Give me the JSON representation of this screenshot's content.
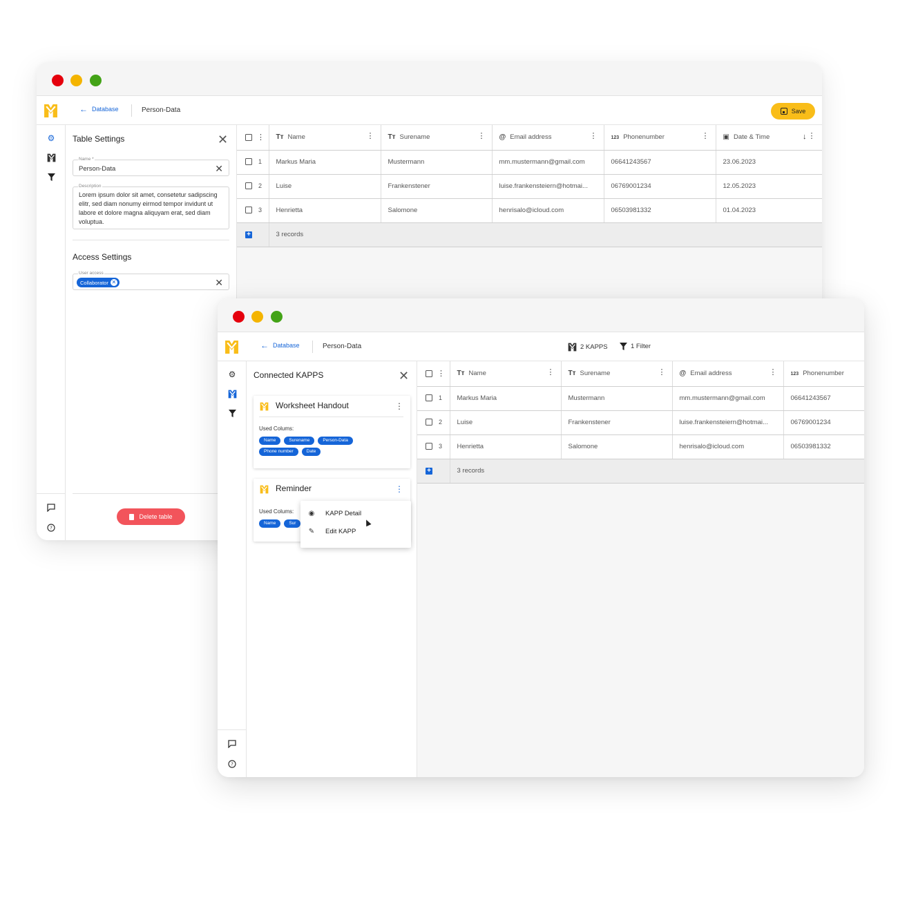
{
  "brand": {
    "accent": "#f9bd19",
    "link": "#1565d8",
    "danger": "#f2545b"
  },
  "back_window": {
    "breadcrumb": {
      "back_label": "Database",
      "current": "Person-Data"
    },
    "save_label": "Save",
    "panel": {
      "title": "Table Settings",
      "name_label": "Name *",
      "name_value": "Person-Data",
      "description_label": "Description",
      "description_value": "Lorem ipsum dolor sit amet, consetetur sadipscing elitr, sed diam nonumy eirmod tempor invidunt ut labore et dolore magna aliquyam erat, sed diam voluptua.",
      "access_title": "Access Settings",
      "user_access_label": "User access",
      "user_access_chip": "Collaborator",
      "delete_label": "Delete table"
    },
    "table": {
      "columns": [
        {
          "icon": "Tт",
          "label": "Name"
        },
        {
          "icon": "Tт",
          "label": "Surename"
        },
        {
          "icon": "@",
          "label": "Email address"
        },
        {
          "icon": "123",
          "label": "Phonenumber"
        },
        {
          "icon": "calendar",
          "label": "Date & Time"
        }
      ],
      "rows": [
        {
          "n": "1",
          "name": "Markus Maria",
          "surname": "Mustermann",
          "email": "mm.mustermann@gmail.com",
          "phone": "06641243567",
          "date": "23.06.2023"
        },
        {
          "n": "2",
          "name": "Luise",
          "surname": "Frankenstener",
          "email": "luise.frankensteiern@hotmai...",
          "phone": "06769001234",
          "date": "12.05.2023"
        },
        {
          "n": "3",
          "name": "Henrietta",
          "surname": "Salomone",
          "email": "henrisalo@icloud.com",
          "phone": "06503981332",
          "date": "01.04.2023"
        }
      ],
      "footer": "3 records"
    }
  },
  "front_window": {
    "breadcrumb": {
      "back_label": "Database",
      "current": "Person-Data"
    },
    "toolbar": {
      "kapps": "2 KAPPS",
      "filter": "1 Filter"
    },
    "panel": {
      "title": "Connected KAPPS",
      "cards": [
        {
          "title": "Worksheet Handout",
          "used_label": "Used Colums:",
          "chips": [
            "Name",
            "Surename",
            "Person-Data",
            "Phone number",
            "Date"
          ]
        },
        {
          "title": "Reminder",
          "used_label": "Used Colums:",
          "chips": [
            "Name",
            "Sur"
          ]
        }
      ],
      "menu": {
        "detail": "KAPP Detail",
        "edit": "Edit KAPP"
      }
    },
    "table": {
      "columns": [
        {
          "icon": "Tт",
          "label": "Name"
        },
        {
          "icon": "Tт",
          "label": "Surename"
        },
        {
          "icon": "@",
          "label": "Email address"
        },
        {
          "icon": "123",
          "label": "Phonenumber"
        }
      ],
      "rows": [
        {
          "n": "1",
          "name": "Markus Maria",
          "surname": "Mustermann",
          "email": "mm.mustermann@gmail.com",
          "phone": "06641243567"
        },
        {
          "n": "2",
          "name": "Luise",
          "surname": "Frankenstener",
          "email": "luise.frankensteiern@hotmai...",
          "phone": "06769001234"
        },
        {
          "n": "3",
          "name": "Henrietta",
          "surname": "Salomone",
          "email": "henrisalo@icloud.com",
          "phone": "06503981332"
        }
      ],
      "footer": "3 records"
    }
  }
}
